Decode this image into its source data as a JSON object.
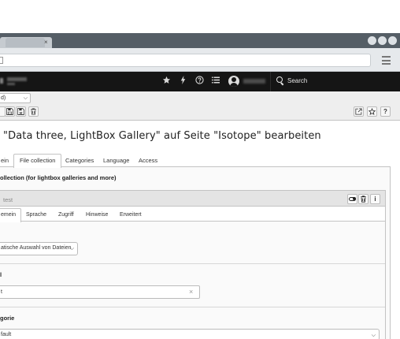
{
  "browser": {
    "tab_close": "×"
  },
  "topbar": {
    "bookmark_icon": "star-icon",
    "flash_icon": "bolt-icon",
    "help_icon": "question-circle-icon",
    "system_info_icon": "list-icon",
    "search_label": "Search"
  },
  "docheader": {
    "language_select": "d)",
    "help_label": "?"
  },
  "page": {
    "title": "\"Data three, LightBox Gallery\" auf Seite \"Isotope\" bearbeiten"
  },
  "main_tabs": [
    {
      "label": "ein",
      "active": false
    },
    {
      "label": "File collection",
      "active": true
    },
    {
      "label": "Categories",
      "active": false
    },
    {
      "label": "Language",
      "active": false
    },
    {
      "label": "Access",
      "active": false
    }
  ],
  "palette_title": "ollection (for lightbox galleries and more)",
  "record": {
    "name": "test",
    "delete_icon": "trash-icon",
    "info_label": "i"
  },
  "sub_tabs": [
    {
      "label": "emein",
      "active": true
    },
    {
      "label": "Sprache",
      "active": false
    },
    {
      "label": "Zugriff",
      "active": false
    },
    {
      "label": "Hinweise",
      "active": false
    },
    {
      "label": "Erweitert",
      "active": false
    }
  ],
  "fields": {
    "type_select": "atische Auswahl von Dateien",
    "title_label": "l",
    "title_value": "t",
    "clear_label": "×",
    "category_label": "gorie",
    "category_select": "fault"
  }
}
